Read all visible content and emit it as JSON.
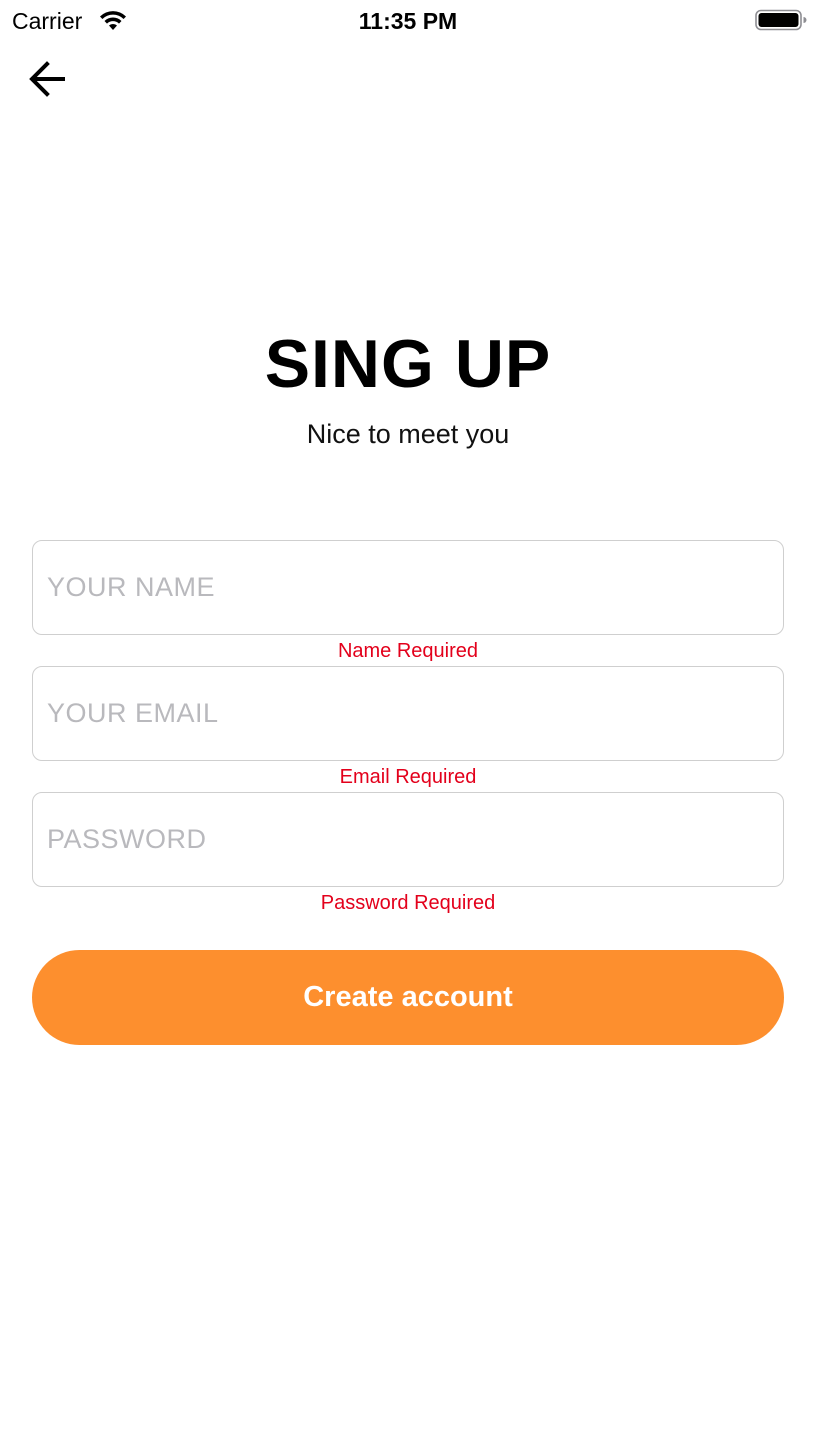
{
  "status_bar": {
    "carrier": "Carrier",
    "time": "11:35 PM",
    "wifi_icon": "wifi-icon",
    "battery_icon": "battery-icon"
  },
  "nav": {
    "back_icon": "arrow-left-icon"
  },
  "header": {
    "title": "SING UP",
    "subtitle": "Nice to meet you"
  },
  "form": {
    "name": {
      "placeholder": "YOUR NAME",
      "value": "",
      "error": "Name Required"
    },
    "email": {
      "placeholder": "YOUR EMAIL",
      "value": "",
      "error": "Email Required"
    },
    "password": {
      "placeholder": "PASSWORD",
      "value": "",
      "error": "Password Required"
    },
    "submit_label": "Create account"
  },
  "colors": {
    "accent": "#fd8f2e",
    "error": "#e3001b",
    "placeholder": "#b9b9bd",
    "border": "#cfcfcf"
  }
}
